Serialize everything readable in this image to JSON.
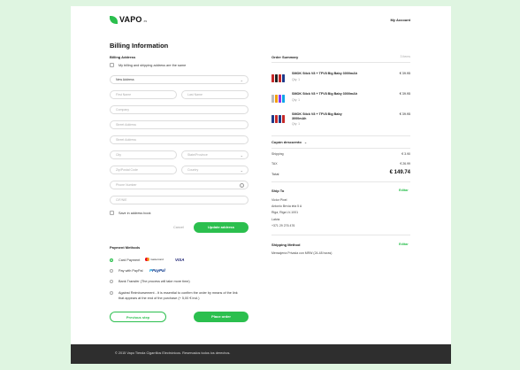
{
  "header": {
    "brand": "VAPO",
    "brand_tld": ".es",
    "account_link": "My Account"
  },
  "billing": {
    "title": "Billing Information",
    "address_section": "Billing Address",
    "same_address_label": "My billing and shipping address are the same",
    "address_select": "New Address",
    "first_name_ph": "First Name",
    "last_name_ph": "Last Name",
    "company_ph": "Company",
    "street1_ph": "Street Address",
    "street2_ph": "Street Address",
    "city_ph": "City",
    "state_ph": "State/Province",
    "zip_ph": "Zip/Postal Code",
    "country_ph": "Country",
    "phone_ph": "Phone Number",
    "cif_ph": "CIF/NIE",
    "save_label": "Save in address book",
    "cancel_label": "Cancel",
    "update_label": "Update address"
  },
  "payment": {
    "title": "Payment Methods",
    "methods": [
      {
        "label": "Card Payment",
        "selected": true
      },
      {
        "label": "Pay with PayPal",
        "selected": false
      },
      {
        "label": "Bank Transfer (The process will take more time)",
        "selected": false
      },
      {
        "label": "Against Reimbursement - It is essential to confirm the order by means of the link",
        "label2": "that appears at the end of the purchase (+ 5,00 € incl.)",
        "selected": false
      }
    ],
    "mastercard": "mastercard",
    "visa": "VISA",
    "paypal": "PayPal"
  },
  "actions": {
    "previous": "Previous step",
    "place": "Place order"
  },
  "summary": {
    "title": "Order Summary",
    "count": "3 Items",
    "items": [
      {
        "name": "SMOK Stick V8 + TFV8 Big Baby 3000mAh",
        "qty": "Qty: 1",
        "price": "€ 39.95"
      },
      {
        "name": "SMOK Stick V8 + TFV8 Big Baby 3000mAh",
        "qty": "Qty: 1",
        "price": "€ 39.95"
      },
      {
        "name": "SMOK Stick V8 + TFV8 Big Baby",
        "name2": "3000mAh",
        "qty": "Qty: 1",
        "price": "€ 39.95"
      }
    ],
    "coupon": "Cupón descuento",
    "shipping_label": "Shipping",
    "shipping_value": "€ 3.90",
    "tax_label": "TAX",
    "tax_value": "€ 26.99",
    "total_label": "Total",
    "total_value": "€ 149.74"
  },
  "ship_to": {
    "title": "Ship To",
    "edit": "Editar",
    "lines": [
      "Victor Pixel",
      "Antonio Brívia iela 5 A",
      "Riga, Riga LV-1001",
      "Latvia",
      "+371 29 276 476"
    ]
  },
  "shipping_method": {
    "title": "Shipping Method",
    "edit": "Editar",
    "value": "Mensajería Privada con MRW (24-48 horas)"
  },
  "footer": {
    "text": "© 2015 Vapo Tienda Cigarrillos Electrónicos. Reservados todos los derechos."
  },
  "colors": {
    "accent": "#2bbf4e",
    "page_bg": "#dff5e1",
    "footer_bg": "#2e2e2e"
  }
}
